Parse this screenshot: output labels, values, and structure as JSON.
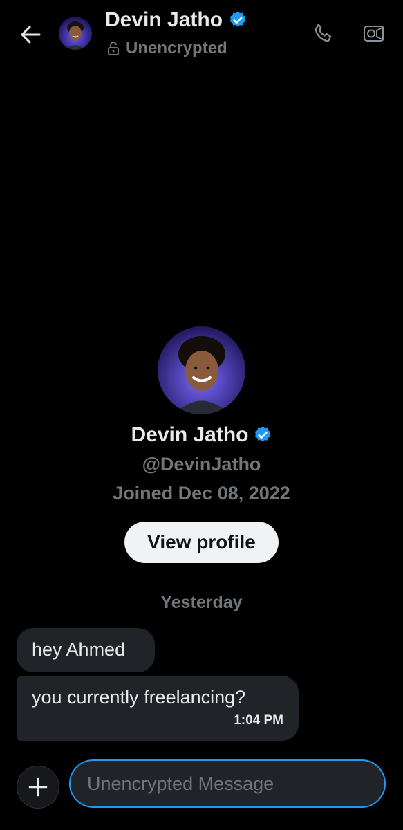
{
  "header": {
    "name": "Devin Jatho",
    "status": "Unencrypted",
    "back_icon": "arrow-left-icon",
    "call_icon": "phone-icon",
    "video_icon": "video-icon",
    "verified_icon": "verified-badge-icon"
  },
  "profile": {
    "name": "Devin Jatho",
    "handle": "@DevinJatho",
    "joined": "Joined Dec 08, 2022",
    "view_profile_label": "View profile"
  },
  "conversation": {
    "date_separator": "Yesterday",
    "messages": [
      {
        "text": "hey Ahmed"
      },
      {
        "text": "you currently freelancing?",
        "time": "1:04 PM"
      }
    ]
  },
  "composer": {
    "placeholder": "Unencrypted Message",
    "add_icon": "plus-icon"
  },
  "colors": {
    "background": "#000000",
    "accent": "#1d9bf0",
    "bubble": "#202327",
    "muted": "#71767b"
  }
}
